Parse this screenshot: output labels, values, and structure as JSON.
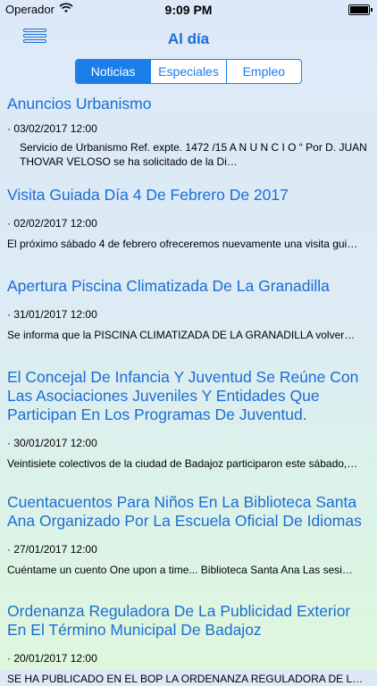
{
  "status_bar": {
    "carrier": "Operador",
    "time": "9:09 PM"
  },
  "nav": {
    "title": "Al día"
  },
  "tabs": [
    {
      "label": "Noticias",
      "active": true
    },
    {
      "label": "Especiales",
      "active": false
    },
    {
      "label": "Empleo",
      "active": false
    }
  ],
  "news": [
    {
      "title": "Anuncios Urbanismo",
      "date": "· 03/02/2017 12:00",
      "excerpt": "Servicio de Urbanismo    Ref. expte. 1472 /15                     A N U N C I O            “ Por  D. JUAN THOVAR VELOSO         se ha solicitado de la Di…"
    },
    {
      "title": "Visita Guiada Día 4 De Febrero De 2017",
      "date": "· 02/02/2017 12:00",
      "excerpt": "El próximo sábado 4 de febrero ofreceremos nuevamente una visita gui…"
    },
    {
      "title": "Apertura Piscina Climatizada De La Granadilla",
      "date": "· 31/01/2017 12:00",
      "excerpt": "Se informa que la PISCINA CLIMATIZADA DE LA GRANADILLA  volver…"
    },
    {
      "title": "El Concejal De Infancia Y Juventud Se Reúne Con Las Asociaciones Juveniles Y Entidades Que Participan En Los Programas De Juventud.",
      "date": "· 30/01/2017 12:00",
      "excerpt": "Veintisiete colectivos de la ciudad de Badajoz  participaron este sábado,…"
    },
    {
      "title": "Cuentacuentos Para Niños En La Biblioteca Santa Ana Organizado Por La Escuela Oficial De Idiomas",
      "date": "· 27/01/2017 12:00",
      "excerpt": "Cuéntame un cuento One upon a time...  Biblioteca Santa Ana  Las sesi…"
    },
    {
      "title": "Ordenanza Reguladora De La Publicidad Exterior En El Término Municipal De Badajoz",
      "date": "· 20/01/2017 12:00",
      "excerpt": "SE HA PUBLICADO EN EL BOP LA ORDENANZA REGULADORA DE LA…"
    }
  ]
}
